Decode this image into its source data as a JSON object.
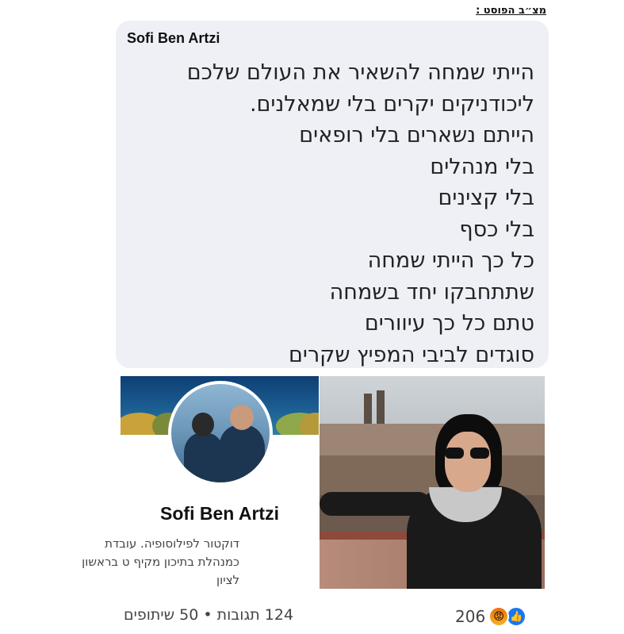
{
  "header": {
    "label": "מצ״ב הפוסט :"
  },
  "post": {
    "author": "Sofi Ben Artzi",
    "lines": [
      "הייתי שמחה להשאיר את העולם שלכם",
      "ליכודניקים יקרים בלי שמאלנים.",
      "הייתם נשארים בלי רופאים",
      "בלי מנהלים",
      "בלי קצינים",
      "בלי כסף",
      "כל כך הייתי שמחה",
      "שתתחבקו יחד בשמחה",
      "טתם כל כך עיוורים",
      "סוגדים לביבי המפיץ שקרים"
    ]
  },
  "profile": {
    "name": "Sofi Ben Artzi",
    "bio_lines": [
      "דוקטור לפילוסופיה. עובדת",
      "כמנהלת בתיכון מקיף ט בראשון",
      "לציון"
    ]
  },
  "reactions": {
    "count": "206",
    "icons": [
      "like-icon",
      "angry-icon"
    ],
    "like_color": "#1877f2",
    "angry_color": "#f0881a"
  },
  "engagement": {
    "text": "124 תגובות • 50 שיתופים"
  }
}
